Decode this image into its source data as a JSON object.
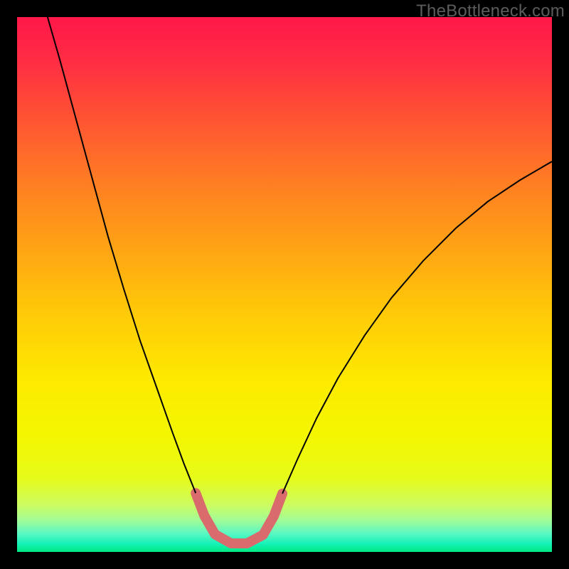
{
  "watermark": "TheBottleneck.com",
  "chart_data": {
    "type": "line",
    "title": "",
    "xlabel": "",
    "ylabel": "",
    "xlim": [
      0,
      100
    ],
    "ylim": [
      0,
      100
    ],
    "grid": false,
    "legend": false,
    "series": [
      {
        "name": "left-descent",
        "stroke": "#000000",
        "stroke_width": 2,
        "points": [
          {
            "x": 5.7,
            "y": 100.0
          },
          {
            "x": 8.0,
            "y": 92.0
          },
          {
            "x": 11.0,
            "y": 81.0
          },
          {
            "x": 14.0,
            "y": 70.0
          },
          {
            "x": 17.0,
            "y": 59.0
          },
          {
            "x": 20.0,
            "y": 49.0
          },
          {
            "x": 23.0,
            "y": 39.5
          },
          {
            "x": 26.0,
            "y": 31.0
          },
          {
            "x": 29.0,
            "y": 22.5
          },
          {
            "x": 31.2,
            "y": 16.5
          },
          {
            "x": 33.4,
            "y": 11.0
          }
        ]
      },
      {
        "name": "valley-highlight",
        "stroke": "#d96b6d",
        "stroke_width": 14,
        "linecap": "round",
        "points": [
          {
            "x": 33.4,
            "y": 11.0
          },
          {
            "x": 35.0,
            "y": 6.8
          },
          {
            "x": 37.0,
            "y": 3.3
          },
          {
            "x": 40.0,
            "y": 1.6
          },
          {
            "x": 43.0,
            "y": 1.6
          },
          {
            "x": 46.0,
            "y": 3.2
          },
          {
            "x": 48.0,
            "y": 6.7
          },
          {
            "x": 49.6,
            "y": 10.9
          }
        ]
      },
      {
        "name": "right-ascent",
        "stroke": "#000000",
        "stroke_width": 2,
        "points": [
          {
            "x": 49.6,
            "y": 10.9
          },
          {
            "x": 52.5,
            "y": 17.5
          },
          {
            "x": 56.0,
            "y": 25.0
          },
          {
            "x": 60.0,
            "y": 32.5
          },
          {
            "x": 65.0,
            "y": 40.5
          },
          {
            "x": 70.0,
            "y": 47.5
          },
          {
            "x": 76.0,
            "y": 54.5
          },
          {
            "x": 82.0,
            "y": 60.5
          },
          {
            "x": 88.0,
            "y": 65.5
          },
          {
            "x": 94.0,
            "y": 69.5
          },
          {
            "x": 100.0,
            "y": 73.0
          }
        ]
      }
    ],
    "background_gradient": {
      "direction": "vertical",
      "stops": [
        {
          "pos": 0.0,
          "color": "#ff1749"
        },
        {
          "pos": 0.08,
          "color": "#ff2c44"
        },
        {
          "pos": 0.18,
          "color": "#ff5034"
        },
        {
          "pos": 0.3,
          "color": "#ff7a24"
        },
        {
          "pos": 0.42,
          "color": "#ffa016"
        },
        {
          "pos": 0.55,
          "color": "#ffc908"
        },
        {
          "pos": 0.68,
          "color": "#fdea00"
        },
        {
          "pos": 0.78,
          "color": "#f4f600"
        },
        {
          "pos": 0.86,
          "color": "#e7fb18"
        },
        {
          "pos": 0.91,
          "color": "#cffc5e"
        },
        {
          "pos": 0.94,
          "color": "#a4fb95"
        },
        {
          "pos": 0.965,
          "color": "#5cf8c3"
        },
        {
          "pos": 0.985,
          "color": "#14f1b7"
        },
        {
          "pos": 1.0,
          "color": "#00e981"
        }
      ]
    },
    "annotations": []
  }
}
